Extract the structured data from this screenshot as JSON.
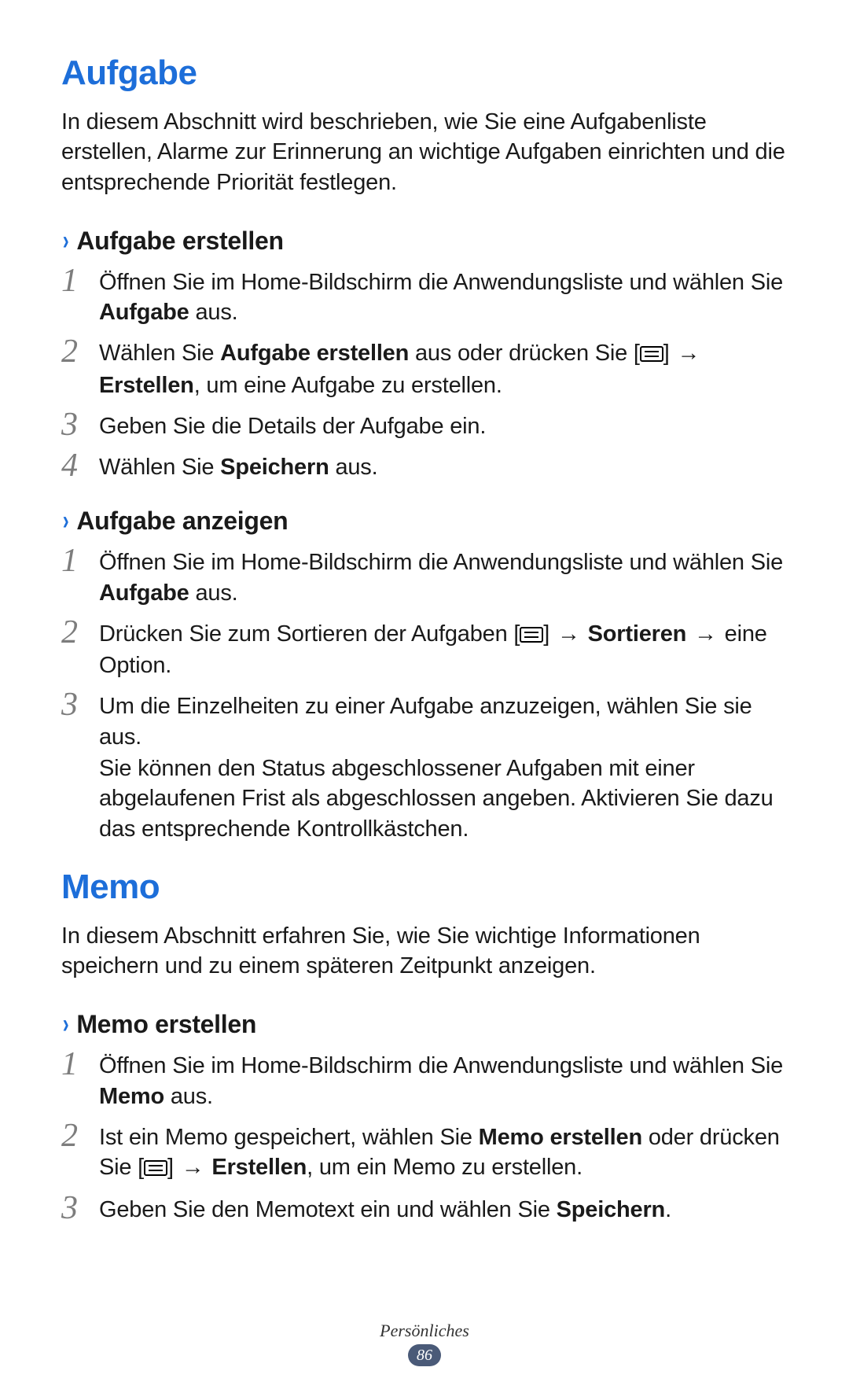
{
  "section1": {
    "title": "Aufgabe",
    "intro": "In diesem Abschnitt wird beschrieben, wie Sie eine Aufgabenliste erstellen, Alarme zur Erinnerung an wichtige Aufgaben einrichten und die entsprechende Priorität festlegen.",
    "sub1": {
      "title": "Aufgabe erstellen",
      "steps": {
        "s1a": "Öffnen Sie im Home-Bildschirm die Anwendungsliste und wählen Sie ",
        "s1b": "Aufgabe",
        "s1c": " aus.",
        "s2a": "Wählen Sie ",
        "s2b": "Aufgabe erstellen",
        "s2c": " aus oder drücken Sie [",
        "s2d": "] ",
        "s2arrow": "→",
        "s2e": " ",
        "s2f": "Erstellen",
        "s2g": ", um eine Aufgabe zu erstellen.",
        "s3": "Geben Sie die Details der Aufgabe ein.",
        "s4a": "Wählen Sie ",
        "s4b": "Speichern",
        "s4c": " aus."
      }
    },
    "sub2": {
      "title": "Aufgabe anzeigen",
      "steps": {
        "s1a": "Öffnen Sie im Home-Bildschirm die Anwendungsliste und wählen Sie ",
        "s1b": "Aufgabe",
        "s1c": " aus.",
        "s2a": "Drücken Sie zum Sortieren der Aufgaben [",
        "s2b": "] ",
        "s2arrow1": "→",
        "s2c": " ",
        "s2d": "Sortieren",
        "s2e": " ",
        "s2arrow2": "→",
        "s2f": " eine Option.",
        "s3a": "Um die Einzelheiten zu einer Aufgabe anzuzeigen, wählen Sie sie aus.",
        "s3b": "Sie können den Status abgeschlossener Aufgaben mit einer abgelaufenen Frist als abgeschlossen angeben. Aktivieren Sie dazu das entsprechende Kontrollkästchen."
      }
    }
  },
  "section2": {
    "title": "Memo",
    "intro": "In diesem Abschnitt erfahren Sie, wie Sie wichtige Informationen speichern und zu einem späteren Zeitpunkt anzeigen.",
    "sub1": {
      "title": "Memo erstellen",
      "steps": {
        "s1a": "Öffnen Sie im Home-Bildschirm die Anwendungsliste und wählen Sie ",
        "s1b": "Memo",
        "s1c": " aus.",
        "s2a": "Ist ein Memo gespeichert, wählen Sie ",
        "s2b": "Memo erstellen",
        "s2c": " oder drücken Sie [",
        "s2d": "] ",
        "s2arrow": "→",
        "s2e": " ",
        "s2f": "Erstellen",
        "s2g": ", um ein Memo zu erstellen.",
        "s3a": "Geben Sie den Memotext ein und wählen Sie ",
        "s3b": "Speichern",
        "s3c": "."
      }
    }
  },
  "nums": {
    "n1": "1",
    "n2": "2",
    "n3": "3",
    "n4": "4"
  },
  "footer": {
    "label": "Persönliches",
    "page": "86"
  }
}
